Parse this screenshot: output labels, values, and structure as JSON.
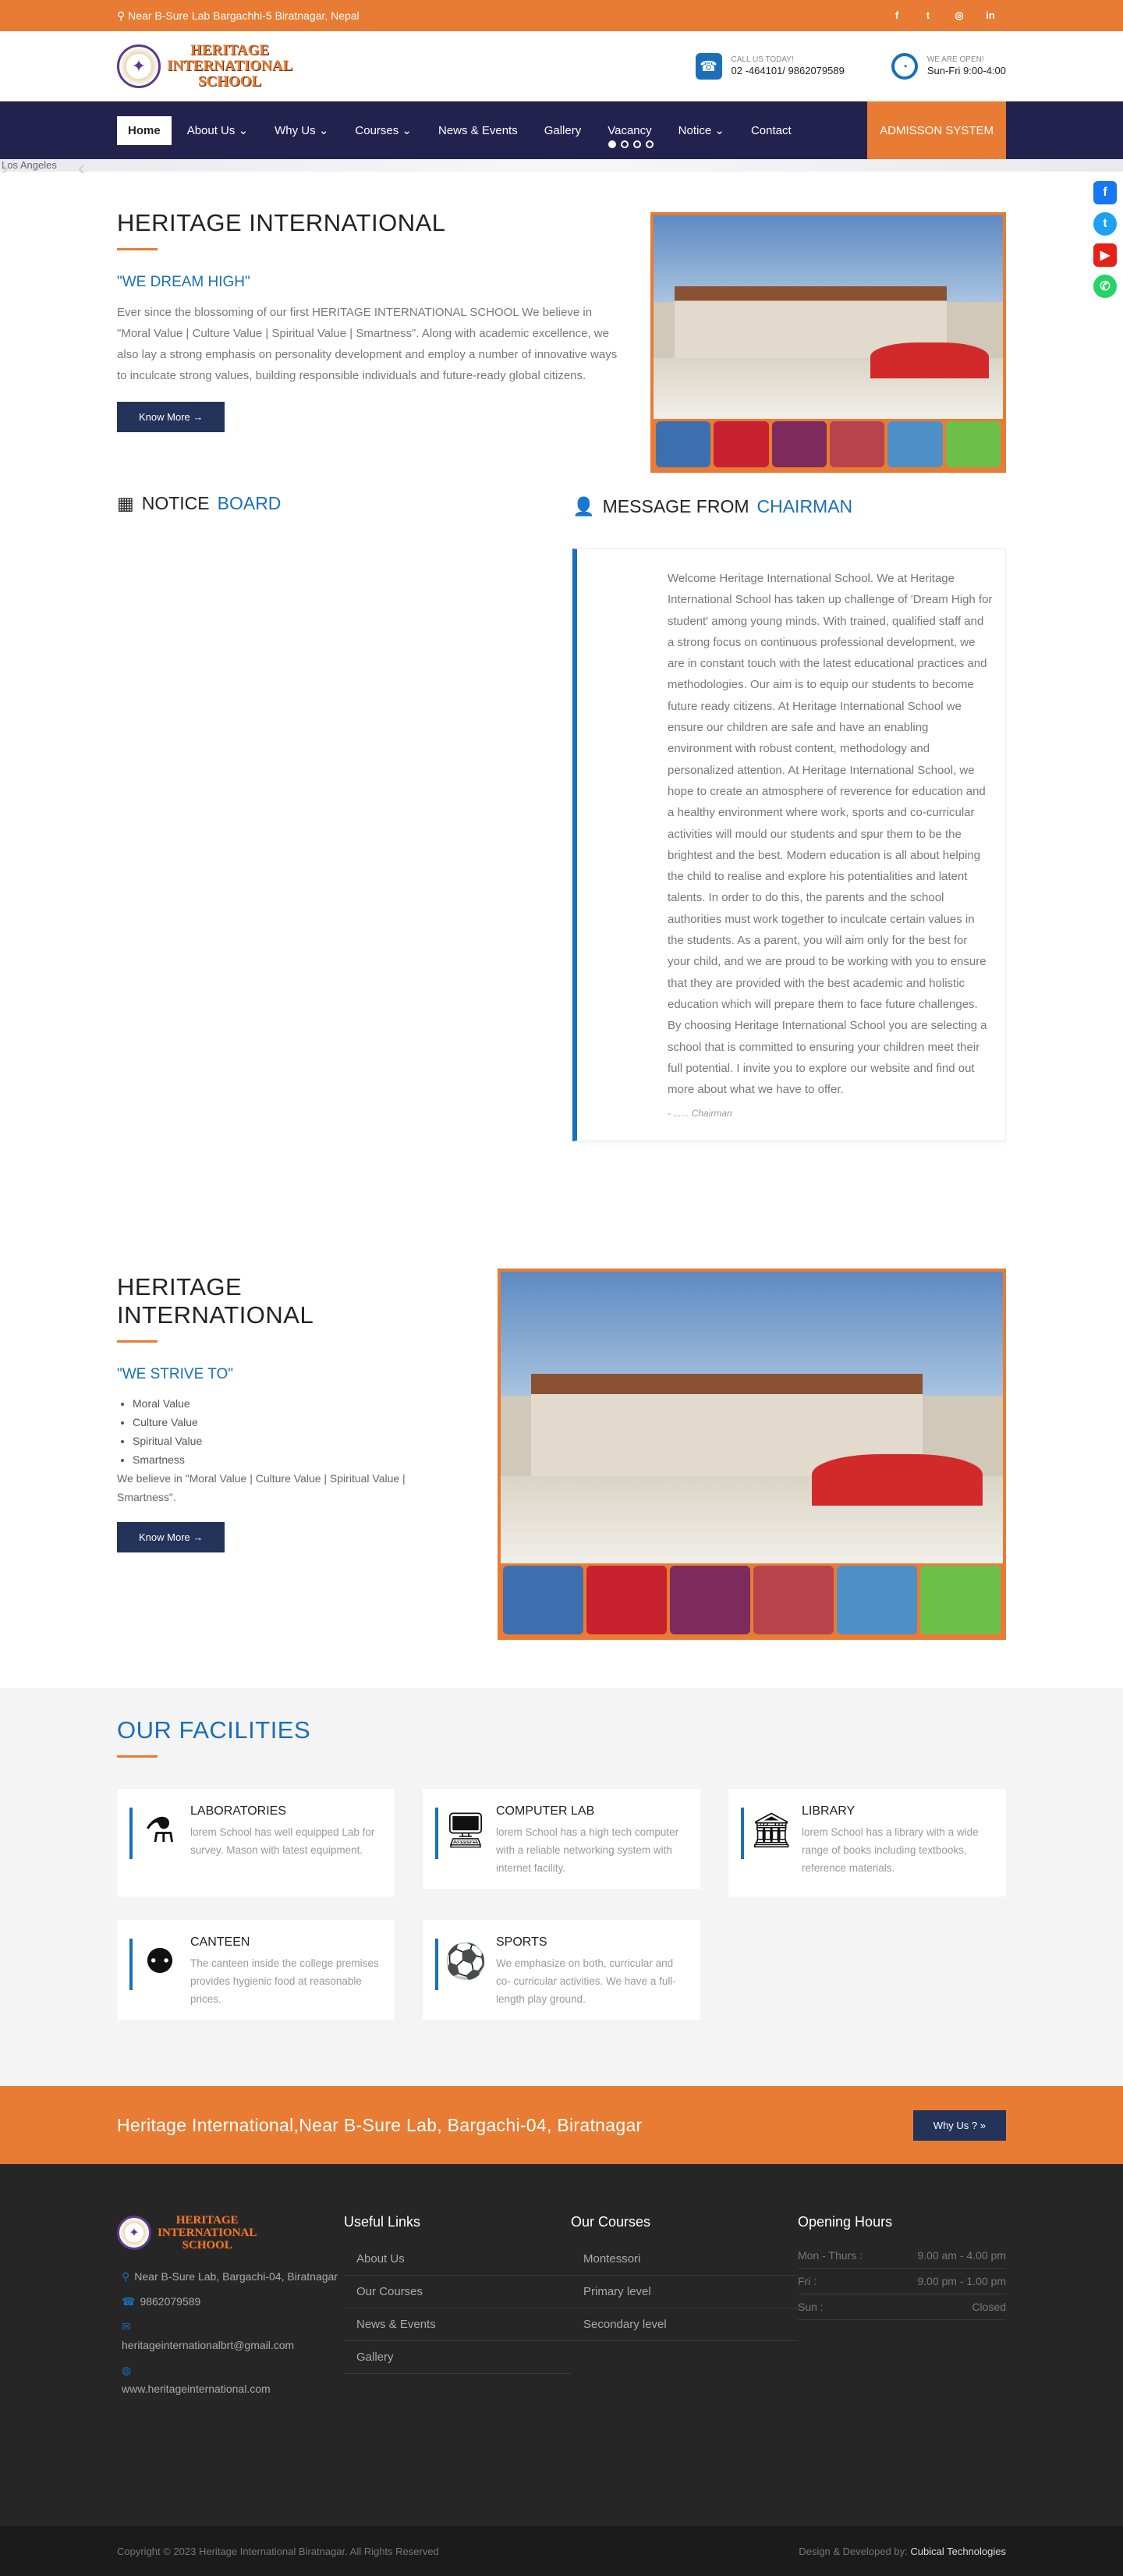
{
  "topbar": {
    "address": "Near B-Sure Lab Bargachhi-5 Biratnagar, Nepal",
    "social": [
      "f",
      "t",
      "◎",
      "in"
    ]
  },
  "header": {
    "logo_lines": [
      "HERITAGE",
      "INTERNATIONAL",
      "SCHOOL"
    ],
    "call_label": "CALL US TODAY!",
    "call_value": "02 -464101/ 9862079589",
    "open_label": "WE ARE OPEN!",
    "open_value": "Sun-Fri 9:00-4:00"
  },
  "nav": {
    "items": [
      "Home",
      "About Us",
      "Why Us",
      "Courses",
      "News & Events",
      "Gallery",
      "Vacancy",
      "Notice",
      "Contact"
    ],
    "admission": "ADMISSON SYSTEM"
  },
  "slider": {
    "alt": "Los Angeles"
  },
  "intro": {
    "title": "HERITAGE INTERNATIONAL",
    "quote": "\"WE DREAM HIGH\"",
    "text": "Ever since the blossoming of our first HERITAGE INTERNATIONAL SCHOOL We believe in \"Moral Value | Culture Value | Spiritual Value | Smartness\". Along with academic excellence, we also lay a strong emphasis on personality development and employ a number of innovative ways to inculcate strong values, building responsible individuals and future-ready global citizens.",
    "button": "Know More →"
  },
  "notice": {
    "title_a": "NOTICE",
    "title_b": "BOARD"
  },
  "message": {
    "title_a": "MESSAGE FROM",
    "title_b": "CHAIRMAN",
    "text": "Welcome Heritage International School. We at Heritage International School has taken up challenge of 'Dream High for student' among young minds. With trained, qualified staff and a strong focus on continuous professional development, we are in constant touch with the latest educational practices and methodologies. Our aim is to equip our students to become future ready citizens. At Heritage International School we ensure our children are safe and have an enabling environment with robust content, methodology and personalized attention. At Heritage International School, we hope to create an atmosphere of reverence for education and a healthy environment where work, sports and co-curricular activities will mould our students and spur them to be the brightest and the best. Modern education is all about helping the child to realise and explore his potentialities and latent talents. In order to do this, the parents and the school authorities must work together to inculcate certain values in the students. As a parent, you will aim only for the best for your child, and we are proud to be working with you to ensure that they are provided with the best academic and holistic education which will prepare them to face future challenges. By choosing Heritage International School you are selecting a school that is committed to ensuring your children meet their full potential. I invite you to explore our website and find out more about what we have to offer.",
    "signature": "- ...... Chairman"
  },
  "strive": {
    "title": "HERITAGE INTERNATIONAL",
    "quote": "\"WE STRIVE TO\"",
    "list": [
      "Moral Value",
      "Culture Value",
      "Spiritual Value",
      "Smartness"
    ],
    "text": "We believe in \"Moral Value | Culture Value | Spiritual Value | Smartness\".",
    "button": "Know More →"
  },
  "facilities": {
    "title": "OUR FACILITIES",
    "items": [
      {
        "icon": "flask-icon",
        "title": "LABORATORIES",
        "text": "lorem School has well equipped Lab for survey. Mason with latest equipment."
      },
      {
        "icon": "computer-icon",
        "title": "COMPUTER LAB",
        "text": "lorem School has a high tech computer with a reliable networking system with internet facility."
      },
      {
        "icon": "library-icon",
        "title": "LIBRARY",
        "text": "lorem School has a library with a wide range of books including textbooks, reference materials."
      },
      {
        "icon": "canteen-icon",
        "title": "CANTEEN",
        "text": "The canteen inside the college premises provides hygienic food at reasonable prices."
      },
      {
        "icon": "ball-icon",
        "title": "SPORTS",
        "text": "We emphasize on both, curricular and co- curricular activities. We have a full- length play ground."
      }
    ]
  },
  "band": {
    "text": "Heritage International,Near B-Sure Lab, Bargachi-04, Biratnagar",
    "button": "Why Us ?"
  },
  "footer": {
    "address": "Near B-Sure Lab, Bargachi-04, Biratnagar",
    "phone": "9862079589",
    "email": "heritageinternationalbrt@gmail.com",
    "web": "www.heritageinternational.com",
    "links_title": "Useful Links",
    "links": [
      "About Us",
      "Our Courses",
      "News & Events",
      "Gallery"
    ],
    "courses_title": "Our Courses",
    "courses": [
      "Montessori",
      "Primary level",
      "Secondary level"
    ],
    "hours_title": "Opening Hours",
    "hours": [
      {
        "day": "Mon - Thurs :",
        "time": "9.00 am - 4.00 pm"
      },
      {
        "day": "Fri :",
        "time": "9.00 pm - 1.00 pm"
      },
      {
        "day": "Sun :",
        "time": "Closed"
      }
    ],
    "copyright": "Copyright © 2023 Heritage International Biratnagar. All Rights Reserved",
    "dev_label": "Design & Developed by:",
    "dev_name": "Cubical Technologies"
  }
}
